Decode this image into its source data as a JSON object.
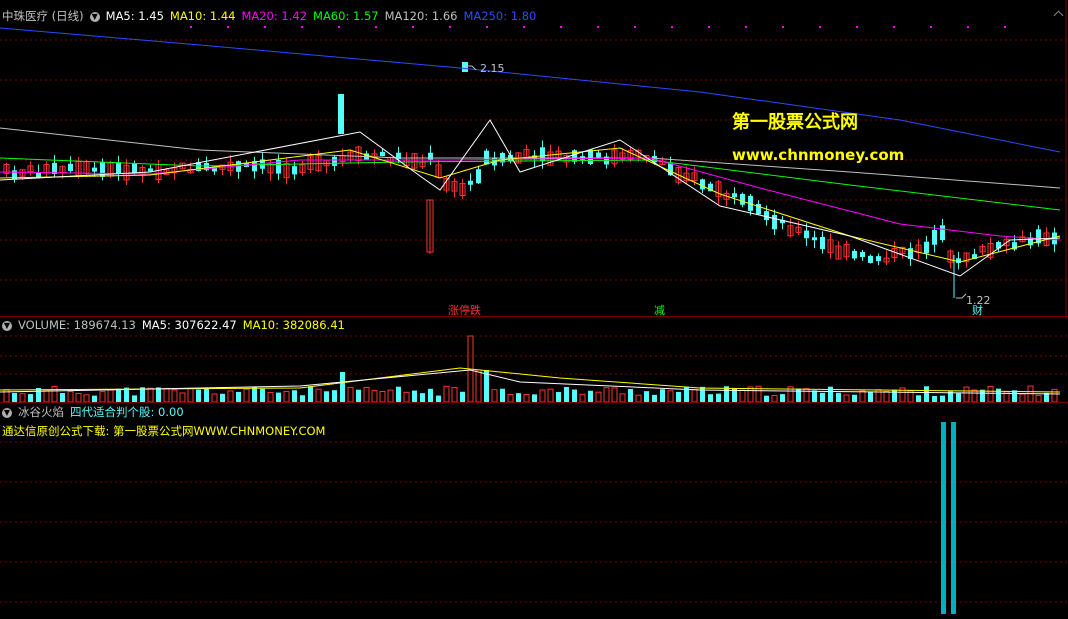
{
  "price": {
    "stock_name": "中珠医疗 (日线)",
    "indicators": [
      {
        "label": "MA5: 1.45",
        "color": "#ffffff"
      },
      {
        "label": "MA10: 1.44",
        "color": "#ffff00"
      },
      {
        "label": "MA20: 1.42",
        "color": "#ff00ff"
      },
      {
        "label": "MA60: 1.57",
        "color": "#00ff00"
      },
      {
        "label": "MA120: 1.66",
        "color": "#c0c0c0"
      },
      {
        "label": "MA250: 1.80",
        "color": "#2a4bff"
      }
    ],
    "high_label": "2.15",
    "low_label": "1.22",
    "annotations": {
      "limit_down": "涨停跌",
      "reduce": "减",
      "finance": "财"
    }
  },
  "volume": {
    "title": "VOLUME: 189674.13",
    "ma5": "MA5: 307622.47",
    "ma10": "MA10: 382086.41"
  },
  "indicator": {
    "title": "冰谷火焰",
    "subtitle": "四代适合判个股: 0.00",
    "source_text": "通达信原创公式下载: 第一股票公式网WWW.CHNMONEY.COM"
  },
  "watermark": {
    "site_name": "第一股票公式网",
    "url": "www.chnmoney.com"
  },
  "colors": {
    "up": "#ff3232",
    "down": "#54fcfc",
    "grid": "#7a0000"
  }
}
